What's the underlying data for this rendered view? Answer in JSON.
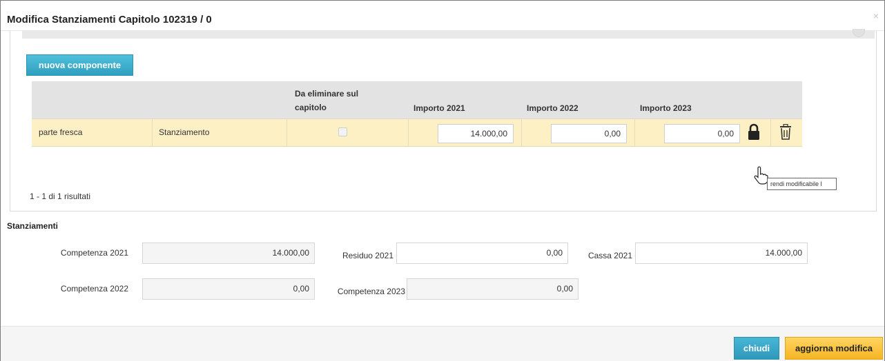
{
  "modal": {
    "title": "Modifica Stanziamenti Capitolo 102319 / 0",
    "close_glyph": "×"
  },
  "toolbar": {
    "new_component_label": "nuova componente"
  },
  "grid": {
    "headers": [
      "",
      "",
      "Da eliminare sul capitolo",
      "Importo 2021",
      "Importo 2022",
      "Importo 2023"
    ],
    "header_line1_col3": "Da eliminare sul",
    "header_line2_col3": "capitolo",
    "rows": [
      {
        "descrizione": "parte fresca",
        "tipo": "Stanziamento",
        "da_eliminare": false,
        "importo_2021": "14.000,00",
        "importo_2022": "0,00",
        "importo_2023": "0,00"
      }
    ],
    "lock_icon": "lock-icon",
    "trash_icon": "trash-icon",
    "tooltip": "rendi modificabile l",
    "results": "1 - 1 di 1 risultati"
  },
  "stanziamenti": {
    "title": "Stanziamenti",
    "competenza_2021_label": "Competenza 2021",
    "competenza_2021": "14.000,00",
    "residuo_2021_label": "Residuo 2021",
    "residuo_2021": "0,00",
    "cassa_2021_label": "Cassa 2021",
    "cassa_2021": "14.000,00",
    "competenza_2022_label": "Competenza 2022",
    "competenza_2022": "0,00",
    "competenza_2023_label": "Competenza 2023",
    "competenza_2023": "0,00"
  },
  "footer": {
    "close_label": "chiudi",
    "update_label": "aggiorna modifica"
  },
  "colors": {
    "primary_button": "#2f9fbe",
    "warning_button": "#f5b524",
    "row_highlight": "#fdf0c5",
    "header_bg": "#e3e3e3"
  }
}
